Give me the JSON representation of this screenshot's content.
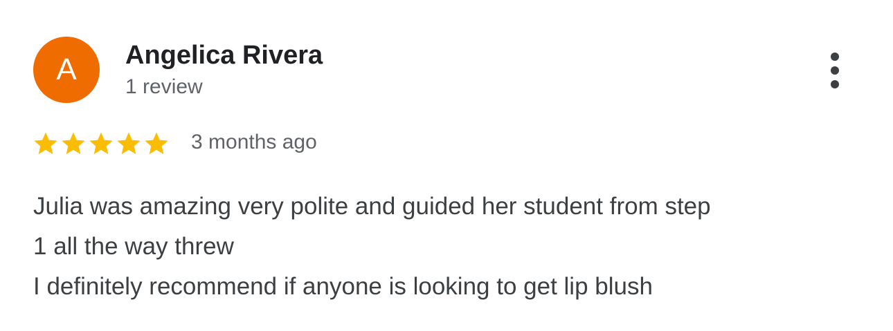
{
  "reviewer": {
    "initial": "A",
    "name": "Angelica Rivera",
    "review_count": "1 review",
    "avatar_color": "#ef6c00"
  },
  "review": {
    "rating": 5,
    "rating_max": 5,
    "star_color": "#fbbc04",
    "time_ago": "3 months ago",
    "text_lines": [
      "Julia was amazing very polite and guided her student from step",
      "1 all the way threw",
      "I definitely recommend if anyone is looking to get lip blush"
    ]
  },
  "icons": {
    "more": "more-vertical-icon",
    "star": "star-icon"
  }
}
